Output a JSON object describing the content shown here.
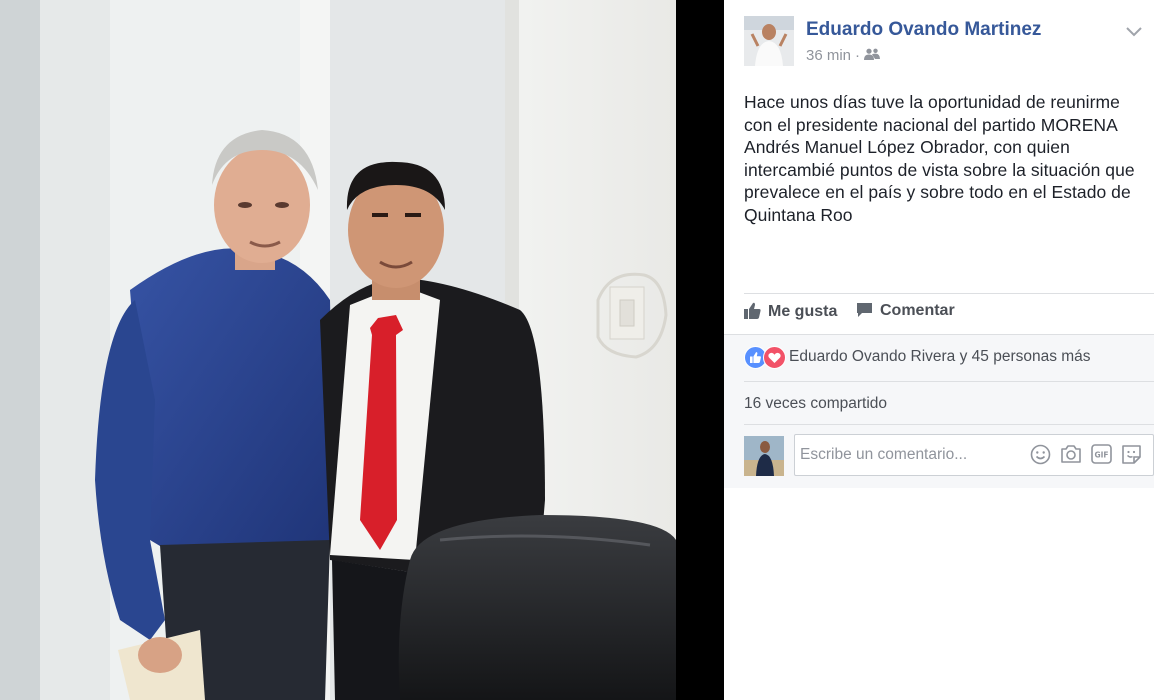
{
  "post": {
    "author": "Eduardo Ovando Martinez",
    "time": "36 min",
    "separator": "·",
    "audience_icon": "friends-icon",
    "text": "Hace unos días tuve la oportunidad de reunirme con el presidente nacional del partido MORENA Andrés Manuel López Obrador, con quien intercambié puntos de vista sobre la situación que prevalece en el país y sobre todo en el Estado de Quintana Roo"
  },
  "actions": {
    "like_label": "Me gusta",
    "comment_label": "Comentar"
  },
  "reactions": {
    "icons": [
      "like-reaction-icon",
      "love-reaction-icon"
    ],
    "text": "Eduardo Ovando Rivera y 45 personas más"
  },
  "shares": {
    "text": "16 veces compartido"
  },
  "comment_box": {
    "placeholder": "Escribe un comentario...",
    "icons": [
      "emoji-icon",
      "camera-icon",
      "gif-icon",
      "sticker-icon"
    ]
  },
  "colors": {
    "link_blue": "#365899",
    "text_dark": "#1d2129",
    "text_gray": "#90949c",
    "like_blue": "#5890ff",
    "love_red": "#f25268"
  }
}
